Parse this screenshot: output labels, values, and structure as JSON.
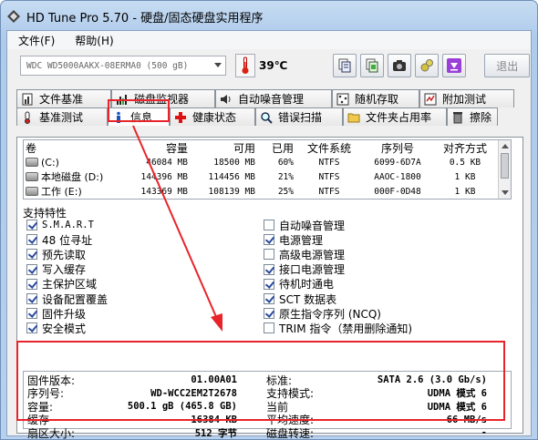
{
  "window": {
    "title": "HD Tune Pro 5.70 - 硬盘/固态硬盘实用程序"
  },
  "menu": {
    "file": "文件(F)",
    "help": "帮助(H)"
  },
  "toolbar": {
    "drive": "WDC WD5000AAKX-08ERMA0 (500 gB)",
    "temperature": "39℃",
    "exit_label": "退出",
    "buttons": [
      "copy-info-icon",
      "copy-screenshot-icon",
      "camera-icon",
      "settings-icon",
      "save-down-icon"
    ]
  },
  "tabs_top": [
    {
      "label": "文件基准",
      "icon": "file-benchmark-icon"
    },
    {
      "label": "磁盘监视器",
      "icon": "disk-monitor-icon"
    },
    {
      "label": "自动噪音管理",
      "icon": "speaker-icon"
    },
    {
      "label": "随机存取",
      "icon": "random-access-icon"
    },
    {
      "label": "附加测试",
      "icon": "extra-tests-icon"
    }
  ],
  "tabs_bottom": [
    {
      "label": "基准测试",
      "icon": "benchmark-icon"
    },
    {
      "label": "信息",
      "icon": "info-icon",
      "active": true
    },
    {
      "label": "健康状态",
      "icon": "health-cross-icon"
    },
    {
      "label": "错误扫描",
      "icon": "error-scan-icon"
    },
    {
      "label": "文件夹占用率",
      "icon": "folder-icon"
    },
    {
      "label": "擦除",
      "icon": "erase-icon"
    }
  ],
  "partitions": {
    "headers": [
      "卷",
      "容量",
      "可用",
      "已用",
      "文件系统",
      "序列号",
      "对齐方式"
    ],
    "rows": [
      [
        "(C:)",
        "46084 MB",
        "18500 MB",
        "60%",
        "NTFS",
        "6099-6D7A",
        "0.5 KB"
      ],
      [
        "本地磁盘 (D:)",
        "144396 MB",
        "114456 MB",
        "21%",
        "NTFS",
        "AAOC-1800",
        "1 KB"
      ],
      [
        "工作 (E:)",
        "143369 MB",
        "108139 MB",
        "25%",
        "NTFS",
        "000F-0D48",
        "1 KB"
      ]
    ]
  },
  "features": {
    "legend": "支持特性",
    "left": [
      {
        "label": "S.M.A.R.T",
        "checked": true
      },
      {
        "label": "48 位寻址",
        "checked": true
      },
      {
        "label": "预先读取",
        "checked": true
      },
      {
        "label": "写入缓存",
        "checked": true
      },
      {
        "label": "主保护区域",
        "checked": true
      },
      {
        "label": "设备配置覆盖",
        "checked": true
      },
      {
        "label": "固件升级",
        "checked": true
      },
      {
        "label": "安全模式",
        "checked": true
      }
    ],
    "right": [
      {
        "label": "自动噪音管理",
        "checked": false
      },
      {
        "label": "电源管理",
        "checked": true
      },
      {
        "label": "高级电源管理",
        "checked": false
      },
      {
        "label": "接口电源管理",
        "checked": true
      },
      {
        "label": "待机时通电",
        "checked": true
      },
      {
        "label": "SCT 数据表",
        "checked": true
      },
      {
        "label": "原生指令序列 (NCQ)",
        "checked": true
      },
      {
        "label": "TRIM 指令（禁用删除通知)",
        "checked": false
      }
    ]
  },
  "info": {
    "left": [
      {
        "label": "固件版本:",
        "value": "01.00A01"
      },
      {
        "label": "序列号:",
        "value": "WD-WCC2EM2T2678"
      },
      {
        "label": "容量:",
        "value": "500.1 gB (465.8 GB)"
      },
      {
        "label": "缓存",
        "value": "16384 KB"
      },
      {
        "label": "扇区大小:",
        "value": "512 字节"
      }
    ],
    "right": [
      {
        "label": "标准:",
        "value": "SATA 2.6 (3.0 Gb/s)"
      },
      {
        "label": "支持模式:",
        "value": "UDMA 模式 6"
      },
      {
        "label": "当前",
        "value": "UDMA 模式 6"
      },
      {
        "label": "平均速度:",
        "value": "66 MB/s"
      },
      {
        "label": "磁盘转速:",
        "value": "-"
      }
    ]
  },
  "colors": {
    "highlight": "#e8242b",
    "title_bar": "#aecbeb"
  }
}
